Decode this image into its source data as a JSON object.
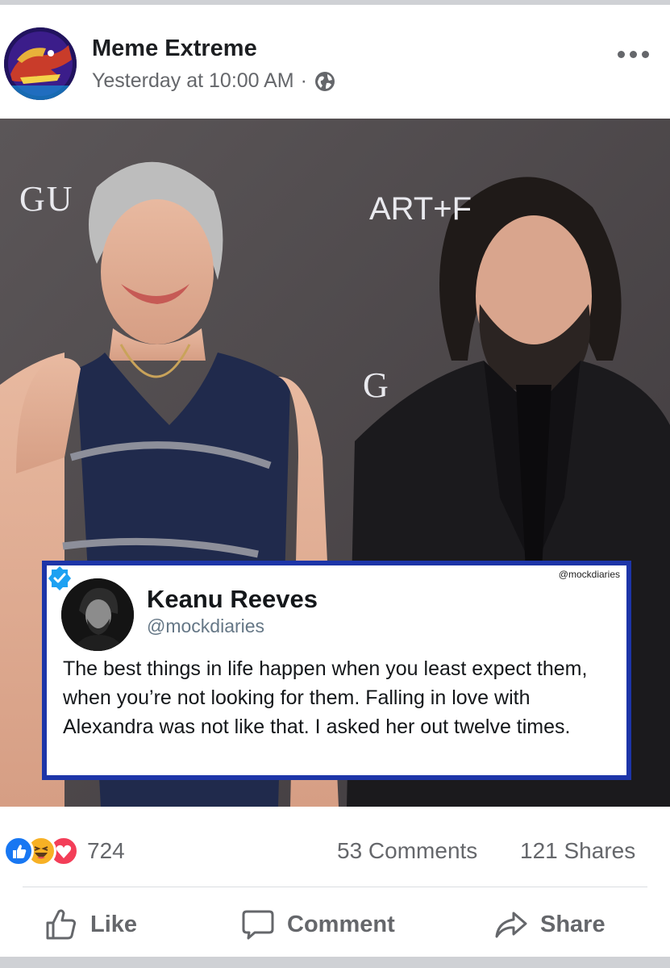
{
  "post": {
    "page_name": "Meme Extreme",
    "timestamp": "Yesterday at 10:00 AM",
    "separator": "·",
    "privacy_icon": "globe-icon"
  },
  "photo": {
    "backdrop_text": [
      "GU",
      "ART+F",
      "G"
    ],
    "tweet": {
      "watermark": "@mockdiaries",
      "display_name": "Keanu Reeves",
      "handle": "@mockdiaries",
      "text": "The best things in life happen when you least expect them, when you’re not looking for them. Falling in love with Alexandra was not like that. I asked her out twelve times.",
      "verified_icon": "verified-badge-icon"
    }
  },
  "stats": {
    "reaction_icons": [
      "like-reaction-icon",
      "haha-reaction-icon",
      "love-reaction-icon"
    ],
    "reaction_count": "724",
    "comments": "53 Comments",
    "shares": "121 Shares"
  },
  "actions": {
    "like": "Like",
    "comment": "Comment",
    "share": "Share"
  },
  "colors": {
    "facebook_blue": "#1877f2",
    "tweet_border": "#1d35a8",
    "twitter_blue": "#1da1f2",
    "secondary_text": "#65676b"
  }
}
